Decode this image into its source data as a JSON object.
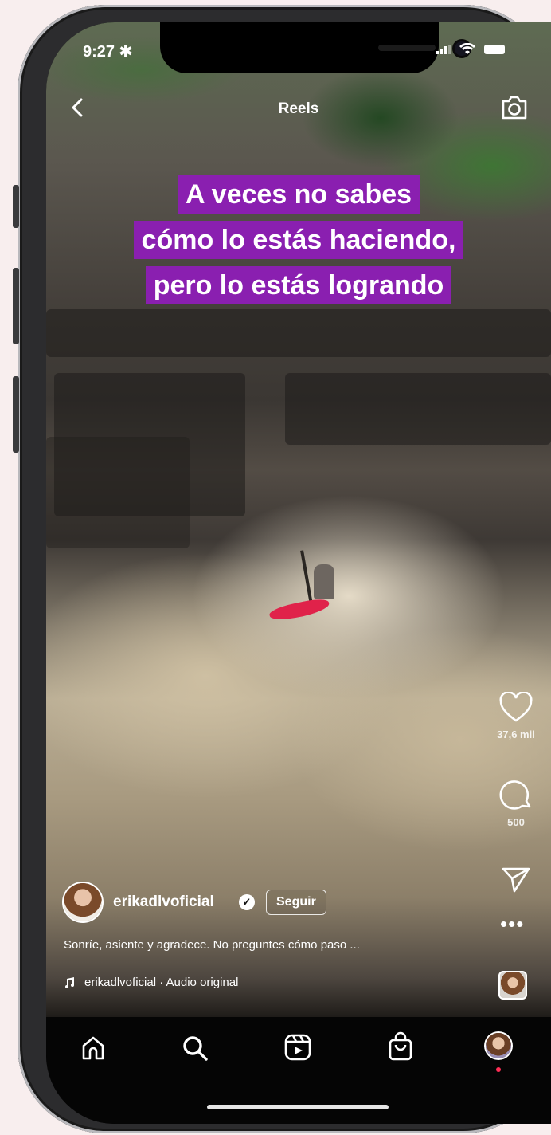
{
  "status": {
    "time": "9:27",
    "time_suffix": "✱"
  },
  "header": {
    "title": "Reels"
  },
  "caption_lines": [
    "A veces no sabes",
    "cómo lo estás haciendo,",
    "pero lo estás logrando"
  ],
  "actions": {
    "likes": "37,6 mil",
    "comments": "500"
  },
  "post": {
    "username": "erikadlvoficial",
    "follow_label": "Seguir",
    "description": "Sonríe, asiente y agradece. No preguntes cómo paso ...",
    "audio": "erikadlvoficial · Audio original"
  },
  "nav": {
    "items": [
      "home-icon",
      "search-icon",
      "reels-icon",
      "shop-icon",
      "profile"
    ]
  },
  "colors": {
    "caption_bg": "#8a1fb0",
    "kayak": "#e0224a",
    "notification": "#ff2d55"
  }
}
